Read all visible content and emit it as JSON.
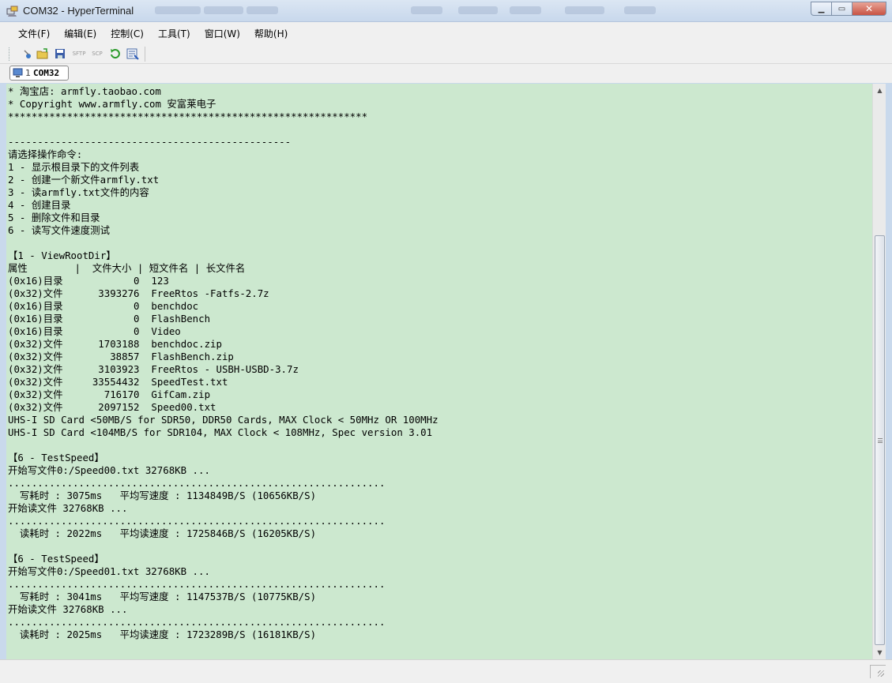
{
  "window": {
    "title": "COM32 - HyperTerminal"
  },
  "menu": [
    "文件(F)",
    "编辑(E)",
    "控制(C)",
    "工具(T)",
    "窗口(W)",
    "帮助(H)"
  ],
  "toolbar": {
    "buttons": [
      "connect-icon",
      "open-icon",
      "save-icon",
      "SFTP",
      "SCP",
      "refresh-icon",
      "log-icon"
    ],
    "sftp_label": "SFTP",
    "scp_label": "SCP"
  },
  "tab": {
    "number": "1",
    "name": "COM32"
  },
  "terminal_lines": [
    "* 淘宝店: armfly.taobao.com",
    "* Copyright www.armfly.com 安富莱电子",
    "*************************************************************",
    "",
    "------------------------------------------------",
    "请选择操作命令:",
    "1 - 显示根目录下的文件列表",
    "2 - 创建一个新文件armfly.txt",
    "3 - 读armfly.txt文件的内容",
    "4 - 创建目录",
    "5 - 删除文件和目录",
    "6 - 读写文件速度测试",
    "",
    "【1 - ViewRootDir】",
    "属性        |  文件大小 | 短文件名 | 长文件名",
    "(0x16)目录            0  123",
    "(0x32)文件      3393276  FreeRtos -Fatfs-2.7z",
    "(0x16)目录            0  benchdoc",
    "(0x16)目录            0  FlashBench",
    "(0x16)目录            0  Video",
    "(0x32)文件      1703188  benchdoc.zip",
    "(0x32)文件        38857  FlashBench.zip",
    "(0x32)文件      3103923  FreeRtos - USBH-USBD-3.7z",
    "(0x32)文件     33554432  SpeedTest.txt",
    "(0x32)文件       716170  GifCam.zip",
    "(0x32)文件      2097152  Speed00.txt",
    "UHS-I SD Card <50MB/S for SDR50, DDR50 Cards, MAX Clock < 50MHz OR 100MHz",
    "UHS-I SD Card <104MB/S for SDR104, MAX Clock < 108MHz, Spec version 3.01",
    "",
    "【6 - TestSpeed】",
    "开始写文件0:/Speed00.txt 32768KB ...",
    "................................................................",
    "  写耗时 : 3075ms   平均写速度 : 1134849B/S (10656KB/S)",
    "开始读文件 32768KB ...",
    "................................................................",
    "  读耗时 : 2022ms   平均读速度 : 1725846B/S (16205KB/S)",
    "",
    "【6 - TestSpeed】",
    "开始写文件0:/Speed01.txt 32768KB ...",
    "................................................................",
    "  写耗时 : 3041ms   平均写速度 : 1147537B/S (10775KB/S)",
    "开始读文件 32768KB ...",
    "................................................................",
    "  读耗时 : 2025ms   平均读速度 : 1723289B/S (16181KB/S)"
  ],
  "colors": {
    "terminal_bg": "#cce8cf",
    "title_bar": "#c8d8ec",
    "close_button": "#c85444"
  },
  "scrollbar": {
    "position": 0.78
  }
}
